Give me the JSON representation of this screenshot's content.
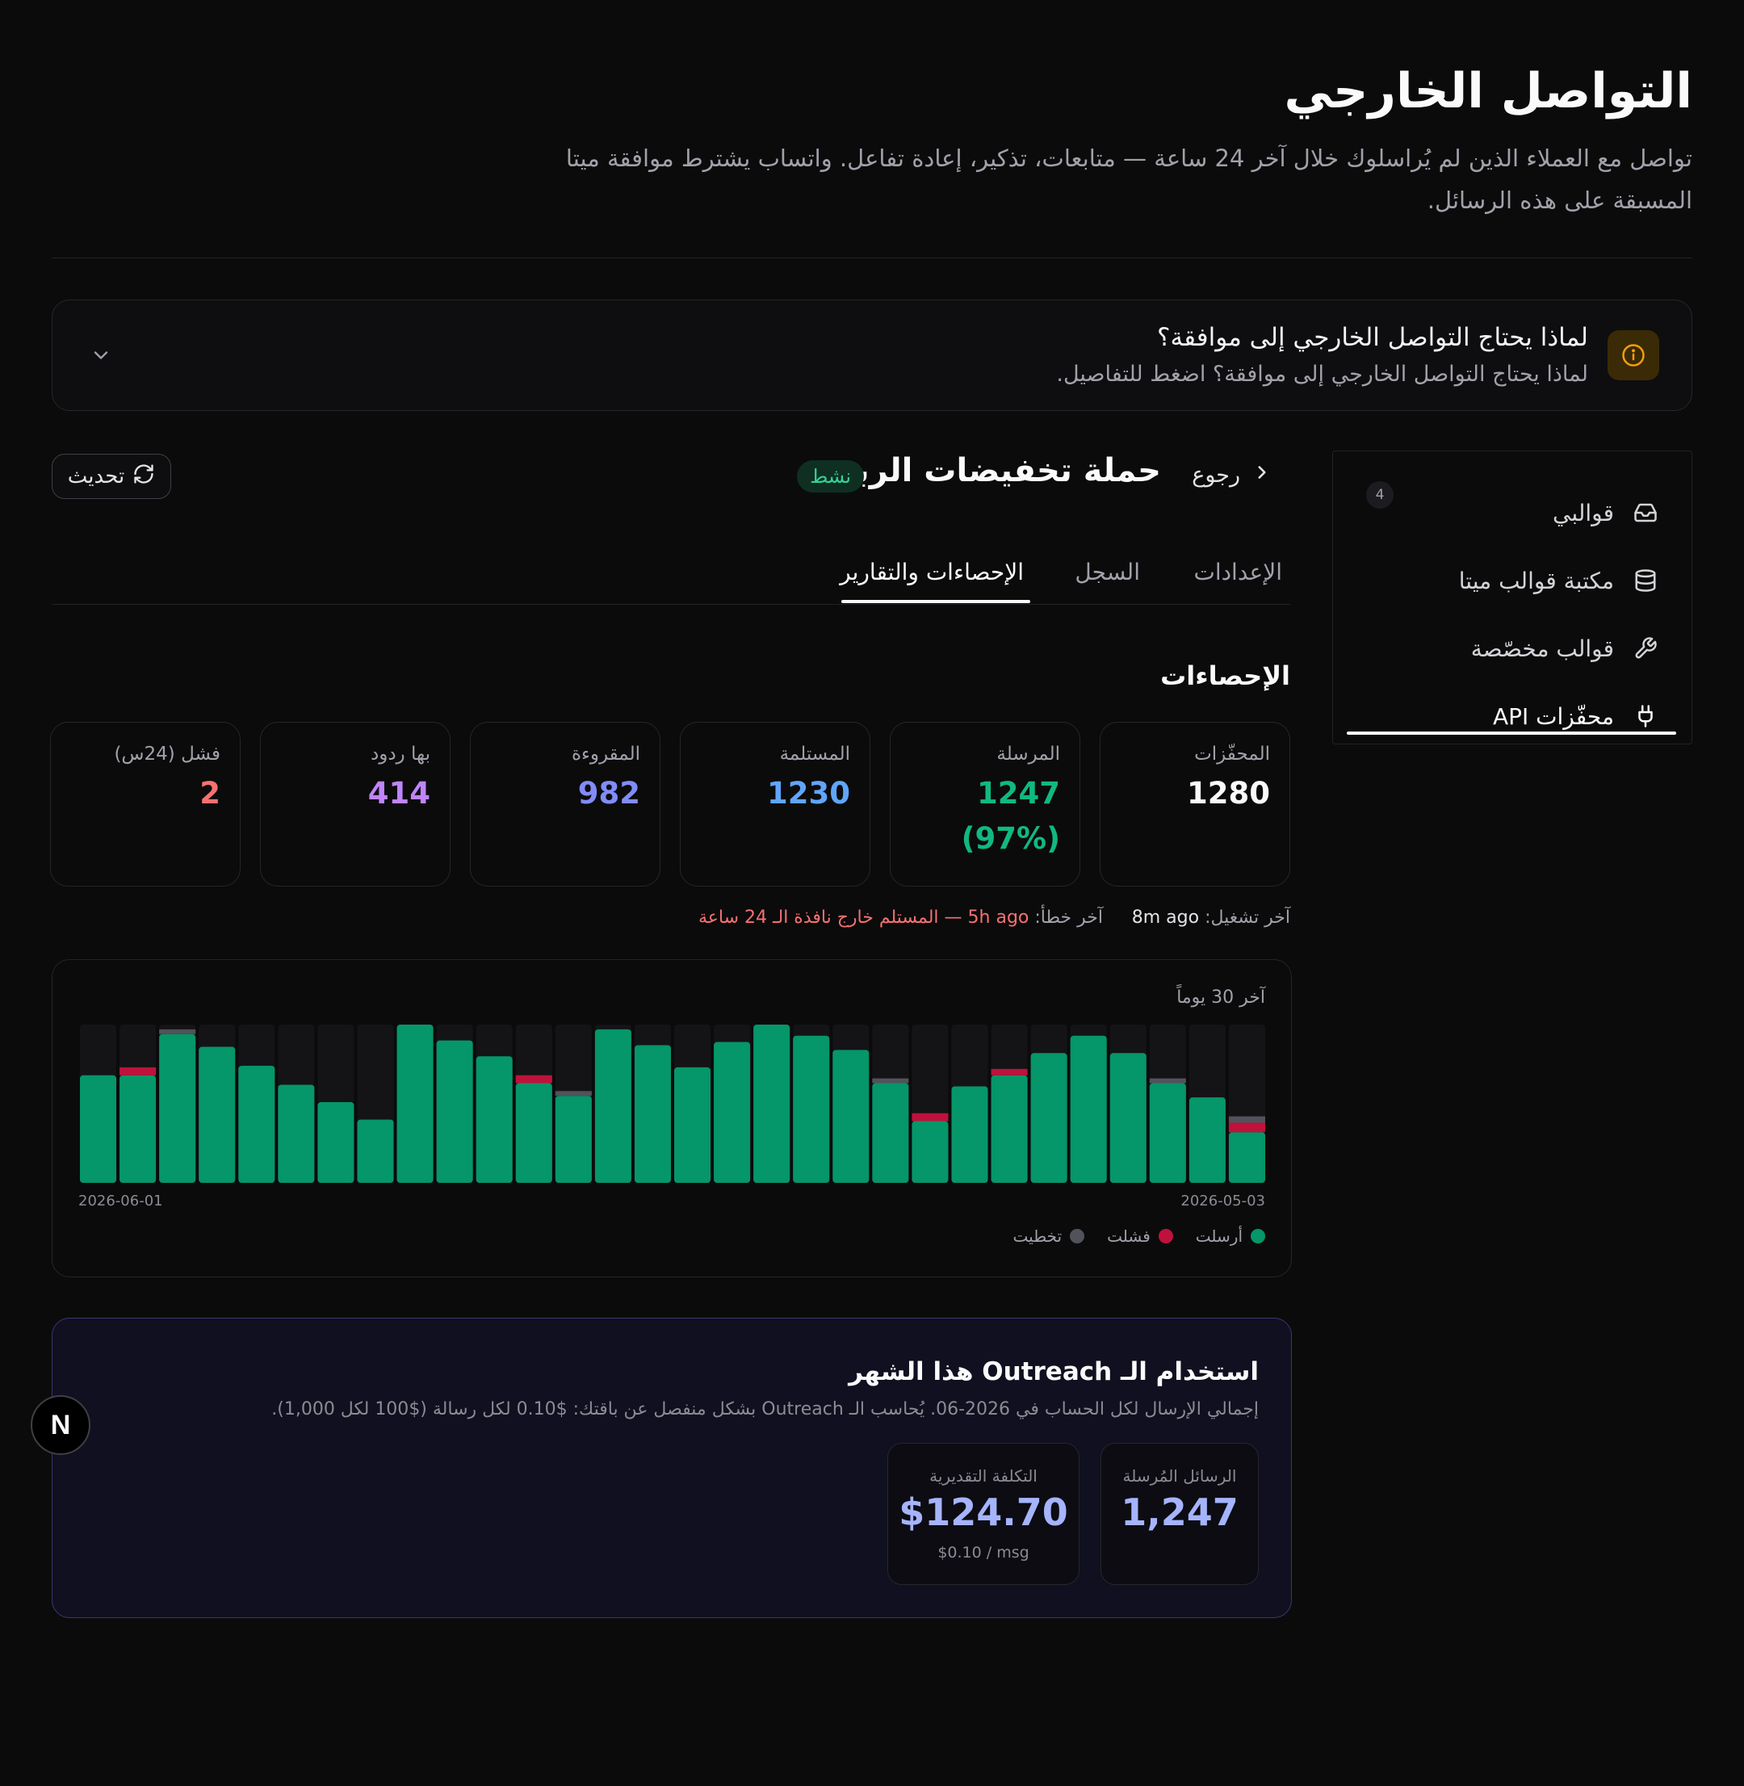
{
  "header": {
    "title": "التواصل الخارجي",
    "subtitle": "تواصل مع العملاء الذين لم يُراسلوك خلال آخر 24 ساعة — متابعات، تذكير، إعادة تفاعل. واتساب يشترط موافقة ميتا المسبقة على هذه الرسائل."
  },
  "info": {
    "title": "لماذا يحتاج التواصل الخارجي إلى موافقة؟",
    "subtitle": "لماذا يحتاج التواصل الخارجي إلى موافقة؟ اضغط للتفاصيل.",
    "icon": "info-icon"
  },
  "sidebar": {
    "items": [
      {
        "label": "قوالبي",
        "icon": "inbox-icon",
        "badge": "4"
      },
      {
        "label": "مكتبة قوالب ميتا",
        "icon": "database-icon"
      },
      {
        "label": "قوالب مخصّصة",
        "icon": "wrench-icon"
      },
      {
        "label": "محفّزات API",
        "icon": "plug-icon",
        "active": true
      }
    ]
  },
  "campaign": {
    "back_label": "رجوع",
    "name": "حملة تخفيضات الربيع",
    "status": "نشط",
    "refresh_label": "تحديث"
  },
  "tabs": [
    {
      "label": "الإعدادات"
    },
    {
      "label": "السجل"
    },
    {
      "label": "الإحصاءات والتقارير",
      "active": true
    }
  ],
  "stats": {
    "section_title": "الإحصاءات",
    "cards": [
      {
        "label": "المحفّزات",
        "value": "1280",
        "color": "#fafafa"
      },
      {
        "label": "المرسلة",
        "value": "1247",
        "value2": "(97%)",
        "color": "#10b981"
      },
      {
        "label": "المستلمة",
        "value": "1230",
        "color": "#60a5fa"
      },
      {
        "label": "المقروءة",
        "value": "982",
        "color": "#818cf8"
      },
      {
        "label": "بها ردود",
        "value": "414",
        "color": "#c084fc"
      },
      {
        "label": "فشل (24س)",
        "value": "2",
        "color": "#f87171"
      }
    ]
  },
  "run": {
    "last_run_label": "آخر تشغيل:",
    "last_run_value": "8m ago",
    "last_error_label": "آخر خطأ:",
    "last_error_value": "5h ago — المستلم خارج نافذة الـ 24 ساعة"
  },
  "chart_data": {
    "type": "bar",
    "title": "آخر 30 يوماً",
    "x_start": "2026-05-03",
    "x_end": "2026-06-01",
    "ylim": [
      0,
      100
    ],
    "colors": {
      "sent": "#059669",
      "failed": "#be123c",
      "skipped": "#52525b",
      "track": "#141416"
    },
    "legend": [
      {
        "name": "أرسلت",
        "color": "#059669"
      },
      {
        "name": "فشلت",
        "color": "#be123c"
      },
      {
        "name": "تخطيت",
        "color": "#52525b"
      }
    ],
    "series": [
      {
        "name": "أرسلت",
        "values": [
          42,
          54,
          66,
          82,
          93,
          82,
          72,
          61,
          44,
          66,
          84,
          93,
          100,
          89,
          73,
          87,
          97,
          58,
          68,
          80,
          90,
          100,
          40,
          51,
          62,
          74,
          86,
          97,
          73,
          68
        ]
      },
      {
        "name": "فشلت",
        "values": [
          6,
          0,
          0,
          0,
          0,
          0,
          4,
          0,
          5,
          0,
          0,
          0,
          0,
          0,
          0,
          0,
          0,
          0,
          5,
          0,
          0,
          0,
          0,
          0,
          0,
          0,
          0,
          0,
          5,
          0
        ]
      },
      {
        "name": "تخطيت",
        "values": [
          4,
          0,
          3,
          0,
          0,
          0,
          0,
          0,
          0,
          3,
          0,
          0,
          0,
          0,
          0,
          0,
          0,
          3,
          0,
          0,
          0,
          0,
          0,
          0,
          0,
          0,
          0,
          3,
          0,
          0
        ]
      }
    ]
  },
  "usage": {
    "title": "استخدام الـ Outreach هذا الشهر",
    "subtitle": "إجمالي الإرسال لكل الحساب في 2026-06. يُحاسب الـ Outreach بشكل منفصل عن باقتك: $0.10 لكل رسالة ($100 لكل 1,000).",
    "messages_label": "الرسائل المُرسلة",
    "messages_value": "1,247",
    "cost_label": "التكلفة التقديرية",
    "cost_value": "$124.70",
    "cost_note": "$0.10 / msg"
  },
  "dev_badge": "N"
}
